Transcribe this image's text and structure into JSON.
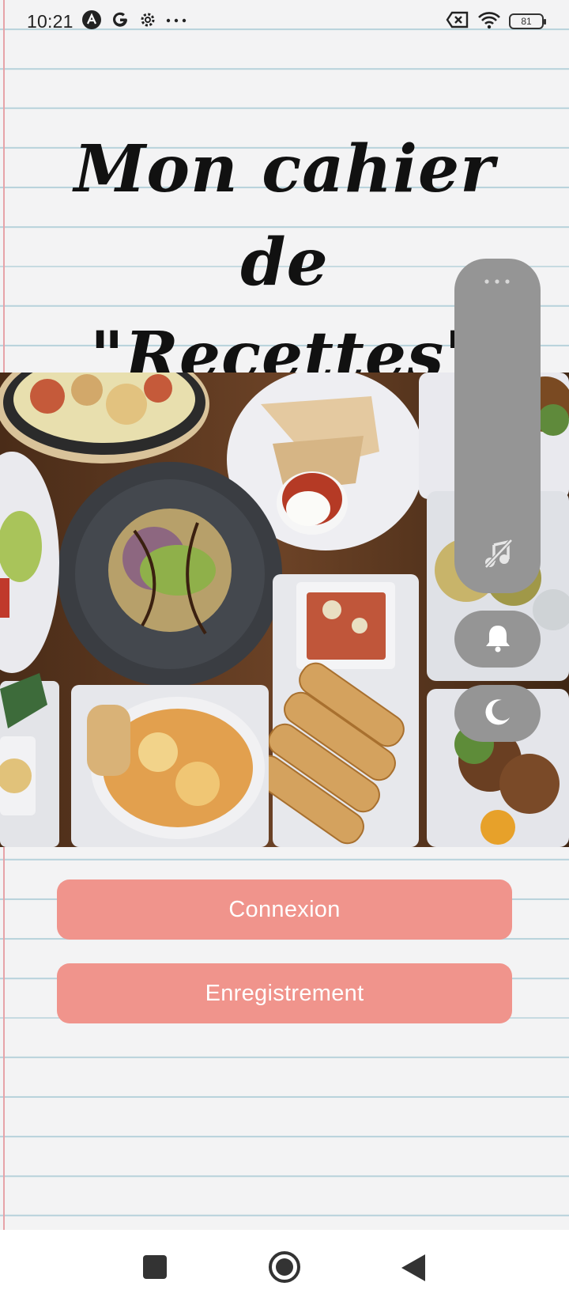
{
  "status_bar": {
    "time": "10:21",
    "battery": "81",
    "icons": [
      "a-icon",
      "google-icon",
      "settings-icon",
      "more-dots-icon",
      "no-sim-icon",
      "wifi-icon",
      "battery-icon"
    ]
  },
  "page": {
    "title_line1": "Mon cahier de",
    "title_line2": "\"Recettes\""
  },
  "buttons": {
    "login": "Connexion",
    "register": "Enregistrement"
  },
  "side_panel": {
    "icons": [
      "more-dots-icon",
      "music-off-icon",
      "bell-icon",
      "moon-icon"
    ]
  },
  "navigation": {
    "icons": [
      "recent-apps-icon",
      "home-icon",
      "back-icon"
    ]
  },
  "colors": {
    "button": "#f0948c",
    "paper": "#f3f3f4",
    "rule_line": "#b9d3dc",
    "margin_line": "#e6a3a8",
    "panel": "#959595"
  }
}
